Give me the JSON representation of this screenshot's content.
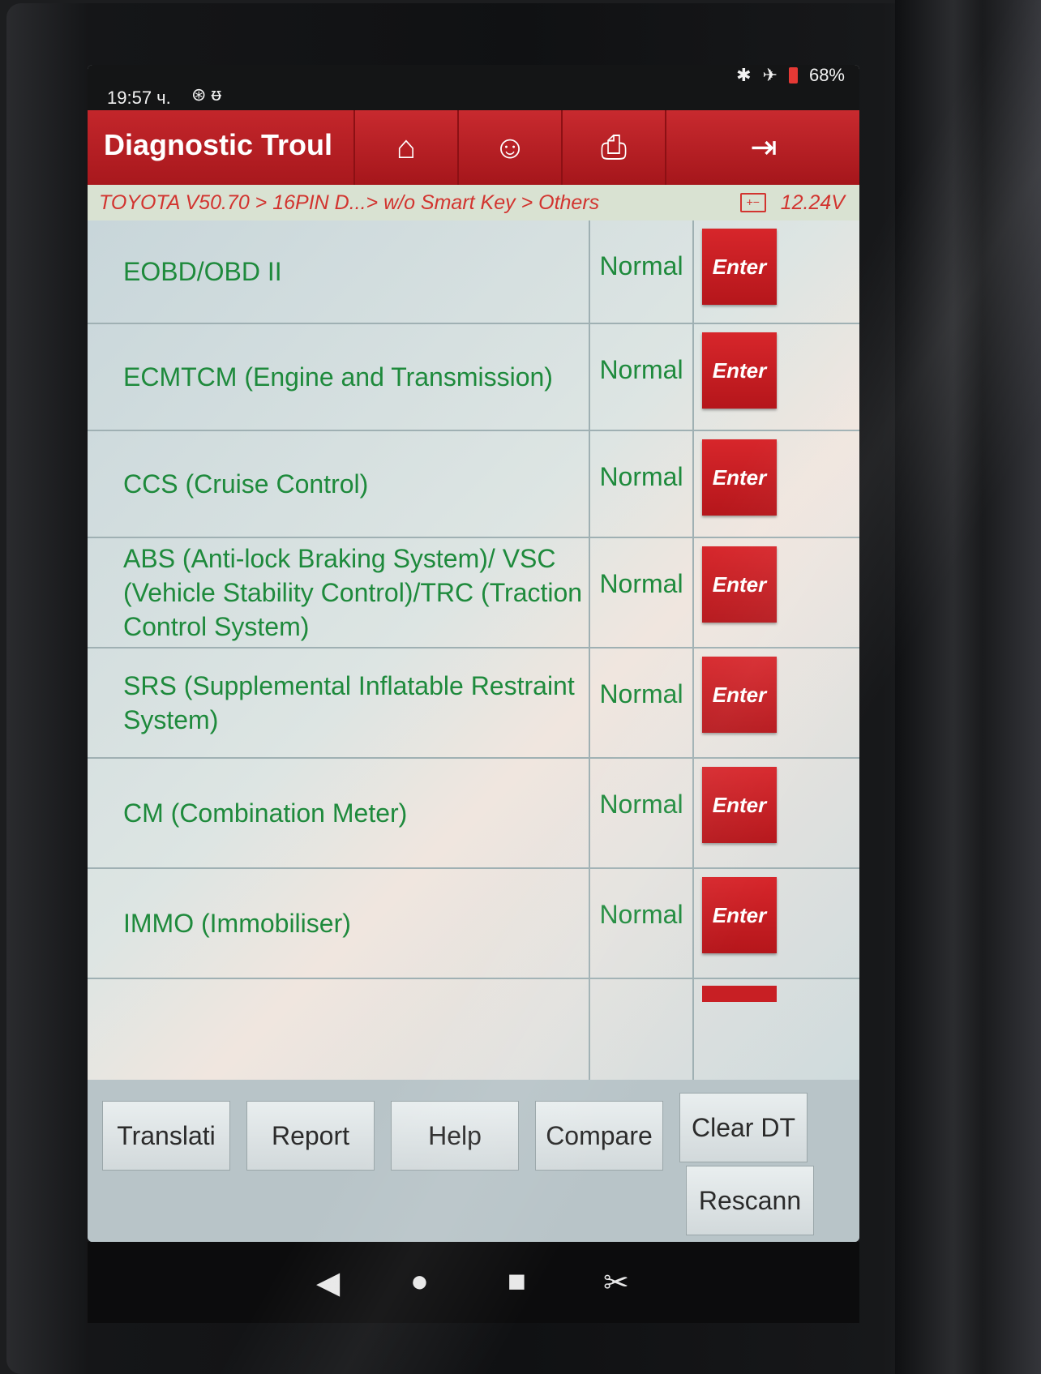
{
  "status_bar": {
    "time": "19:57 ч.",
    "icons_left": [
      "steering-wheel-icon",
      "stethoscope-icon"
    ],
    "icons_right": [
      "bluetooth-icon",
      "airplane-mode-icon",
      "battery-icon"
    ],
    "battery": "68%"
  },
  "title_bar": {
    "title": "Diagnostic Troul",
    "buttons": [
      "home-icon",
      "user-support-icon",
      "print-icon",
      "exit-icon"
    ]
  },
  "breadcrumb": {
    "path": "TOYOTA V50.70 > 16PIN D...> w/o Smart Key > Others",
    "voltage": "12.24V"
  },
  "systems": [
    {
      "name": "EOBD/OBD II",
      "status": "Normal",
      "action": "Enter"
    },
    {
      "name": "ECMTCM (Engine and Transmission)",
      "status": "Normal",
      "action": "Enter"
    },
    {
      "name": "CCS (Cruise Control)",
      "status": "Normal",
      "action": "Enter"
    },
    {
      "name": "ABS (Anti-lock Braking System)/ VSC (Vehicle Stability Control)/TRC (Traction Control System)",
      "status": "Normal",
      "action": "Enter"
    },
    {
      "name": "SRS (Supplemental Inflatable Restraint System)",
      "status": "Normal",
      "action": "Enter"
    },
    {
      "name": "CM (Combination Meter)",
      "status": "Normal",
      "action": "Enter"
    },
    {
      "name": "IMMO (Immobiliser)",
      "status": "Normal",
      "action": "Enter"
    }
  ],
  "toolbar": {
    "translate": "Translati",
    "report": "Report",
    "help": "Help",
    "compare": "Compare",
    "clear_dtc": "Clear DT",
    "rescan": "Rescann"
  },
  "nav": [
    "back-icon",
    "home-circle-icon",
    "recents-icon",
    "screenshot-icon"
  ],
  "colors": {
    "accent_red": "#c3262b",
    "list_text_green": "#1e8a3c",
    "breadcrumb_text": "#d2342f"
  }
}
